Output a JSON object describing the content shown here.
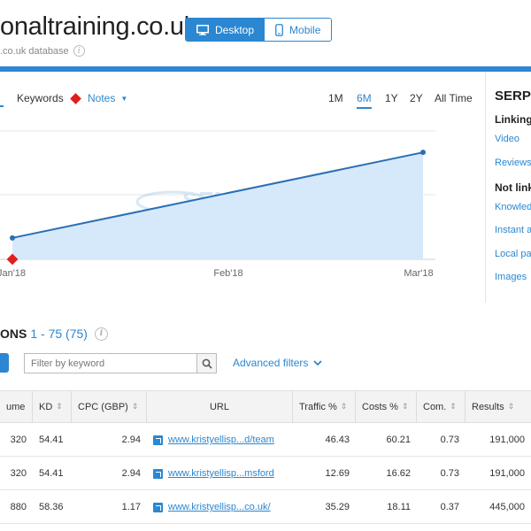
{
  "header": {
    "domain": "onaltraining.co.uk",
    "database": ".co.uk database",
    "device_desktop": "Desktop",
    "device_mobile": "Mobile"
  },
  "chart_toolbar": {
    "keywords_tab": "Keywords",
    "notes_label": "Notes",
    "ranges": [
      "1M",
      "6M",
      "1Y",
      "2Y",
      "All Time"
    ],
    "active_range": "6M"
  },
  "serp": {
    "title": "SERP",
    "linking_head": "Linking",
    "linking_items": [
      "Video",
      "Reviews"
    ],
    "not_linking_head": "Not link",
    "not_linking_items": [
      "Knowled",
      "Instant a",
      "Local pa",
      "Images"
    ]
  },
  "chart_data": {
    "type": "area",
    "x": [
      "Jan'18",
      "Mar'18"
    ],
    "x_tick_labels": [
      "Jan'18",
      "Feb'18",
      "Mar'18"
    ],
    "xlabel": "",
    "ylabel": "",
    "series": [
      {
        "points": [
          {
            "x": "2018-01-01",
            "y": 1
          },
          {
            "x": "2018-03-01",
            "y": 5
          }
        ]
      }
    ],
    "ylim": [
      0,
      6
    ],
    "grid": true,
    "notes_markers": [
      "Jan'18"
    ],
    "watermark": "SEMRUSH",
    "colors": {
      "line": "#2a6fb5",
      "fill": "#d6e9fa",
      "note": "#e01e1e"
    }
  },
  "section": {
    "title": "ONS",
    "range": "1 - 75 (75)"
  },
  "filters": {
    "placeholder": "Filter by keyword",
    "advanced": "Advanced filters"
  },
  "table": {
    "headers": [
      "ume",
      "KD",
      "CPC (GBP)",
      "URL",
      "Traffic %",
      "Costs %",
      "Com.",
      "Results"
    ],
    "rows": [
      {
        "volume": "320",
        "kd": "54.41",
        "cpc": "2.94",
        "url": "www.kristyellisp...d/team",
        "traffic": "46.43",
        "costs": "60.21",
        "com": "0.73",
        "results": "191,000"
      },
      {
        "volume": "320",
        "kd": "54.41",
        "cpc": "2.94",
        "url": "www.kristyellisp...msford",
        "traffic": "12.69",
        "costs": "16.62",
        "com": "0.73",
        "results": "191,000"
      },
      {
        "volume": "880",
        "kd": "58.36",
        "cpc": "1.17",
        "url": "www.kristyellisp...co.uk/",
        "traffic": "35.29",
        "costs": "18.11",
        "com": "0.37",
        "results": "445,000"
      }
    ]
  },
  "colors": {
    "accent": "#2b87d1",
    "header_rule": "#2d86d4"
  }
}
